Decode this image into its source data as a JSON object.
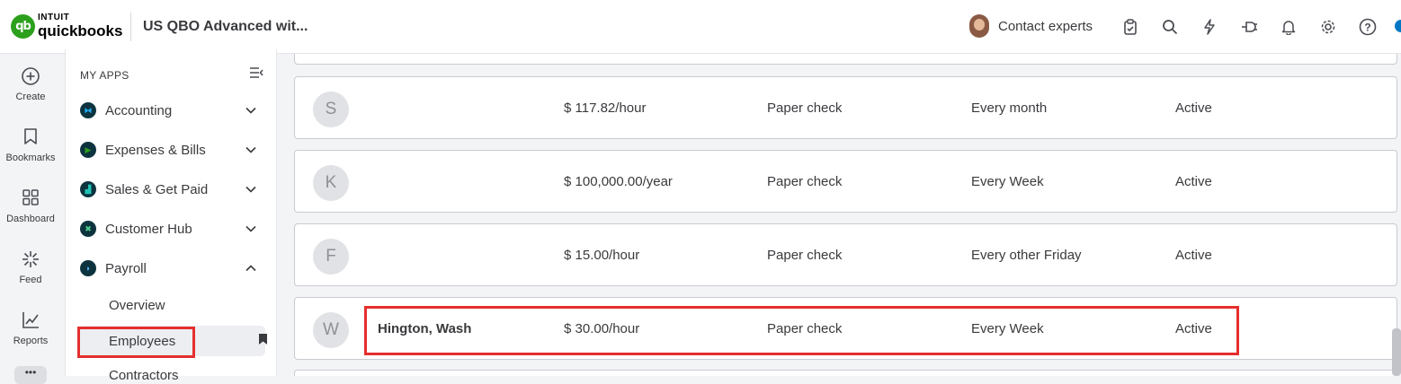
{
  "header": {
    "logo_intuit": "INTUIT",
    "logo_brand": "quickbooks",
    "logo_mark": "qb",
    "company": "US QBO Advanced wit...",
    "contact_label": "Contact experts",
    "icons": [
      "clipboard-icon",
      "search-icon",
      "lightning-icon",
      "plug-icon",
      "bell-icon",
      "gear-icon",
      "help-icon"
    ]
  },
  "rail": {
    "items": [
      {
        "label": "Create",
        "icon": "plus-circle-icon"
      },
      {
        "label": "Bookmarks",
        "icon": "bookmark-icon"
      },
      {
        "label": "Dashboard",
        "icon": "grid-icon"
      },
      {
        "label": "Feed",
        "icon": "sparkle-icon"
      },
      {
        "label": "Reports",
        "icon": "chart-icon"
      }
    ],
    "more_label": "•••"
  },
  "sidebar": {
    "heading": "MY APPS",
    "items": [
      {
        "label": "Accounting",
        "expanded": false
      },
      {
        "label": "Expenses & Bills",
        "expanded": false
      },
      {
        "label": "Sales & Get Paid",
        "expanded": false
      },
      {
        "label": "Customer Hub",
        "expanded": false
      },
      {
        "label": "Payroll",
        "expanded": true
      }
    ],
    "sub_items": [
      {
        "label": "Overview"
      },
      {
        "label": "Employees",
        "active": true
      },
      {
        "label": "Contractors"
      }
    ]
  },
  "employees": {
    "rows": [
      {
        "initial": "S",
        "name": "",
        "pay": "$ 117.82/hour",
        "method": "Paper check",
        "frequency": "Every month",
        "status": "Active"
      },
      {
        "initial": "K",
        "name": "",
        "pay": "$ 100,000.00/year",
        "method": "Paper check",
        "frequency": "Every Week",
        "status": "Active"
      },
      {
        "initial": "F",
        "name": "",
        "pay": "$ 15.00/hour",
        "method": "Paper check",
        "frequency": "Every other Friday",
        "status": "Active"
      },
      {
        "initial": "W",
        "name": "Hington, Wash",
        "pay": "$ 30.00/hour",
        "method": "Paper check",
        "frequency": "Every Week",
        "status": "Active"
      }
    ]
  },
  "colors": {
    "highlight": "#e52e2e",
    "brand_green": "#2ca01c",
    "nav_dot": "#0d333f"
  }
}
